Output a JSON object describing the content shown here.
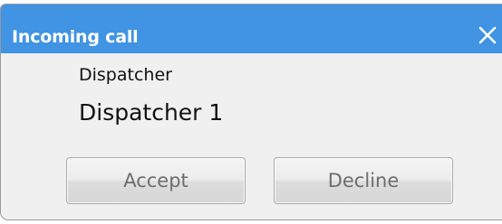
{
  "window": {
    "title": "Incoming call",
    "titlebar_color": "#4193e3"
  },
  "caller": {
    "type_label": "Dispatcher",
    "name": "Dispatcher 1"
  },
  "actions": {
    "accept_label": "Accept",
    "decline_label": "Decline"
  },
  "icons": {
    "close": "close-icon"
  }
}
